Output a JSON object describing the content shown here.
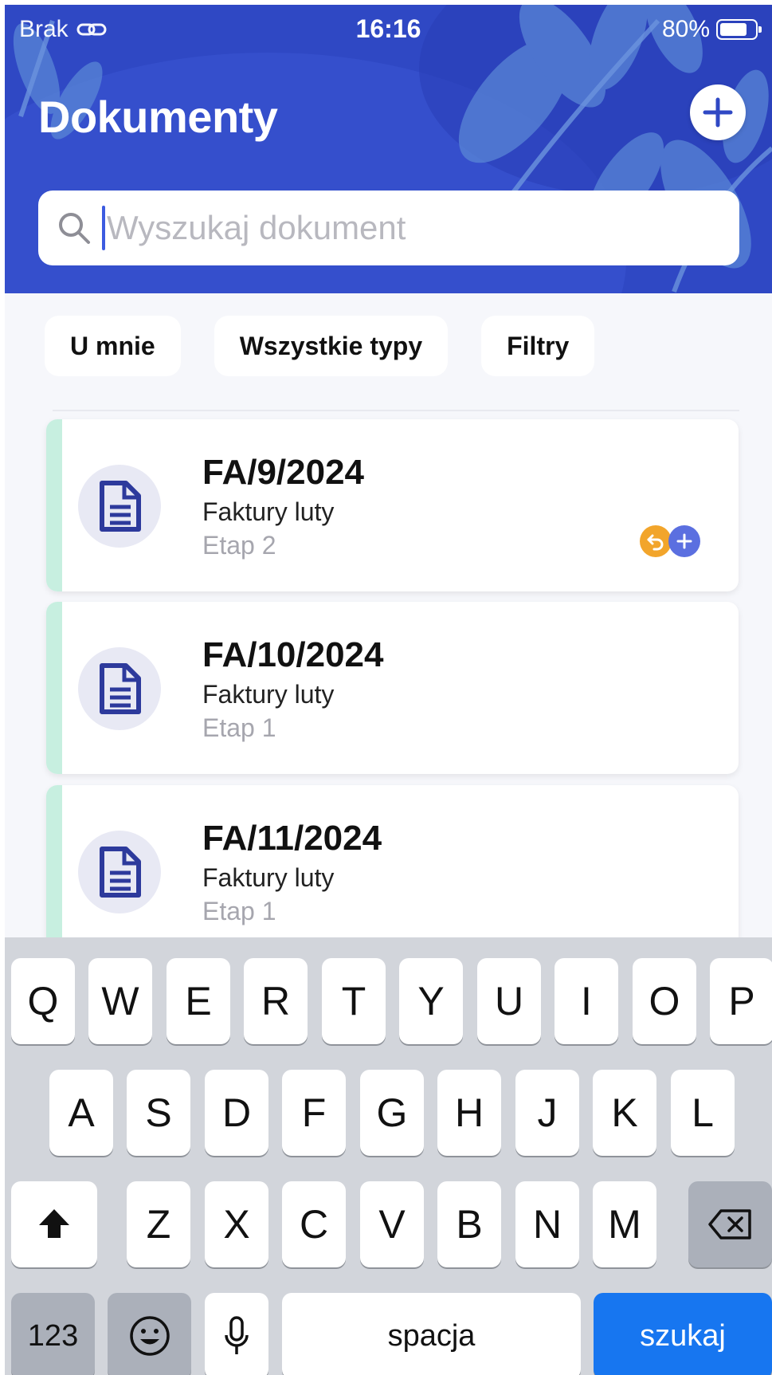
{
  "status_bar": {
    "carrier": "Brak",
    "time": "16:16",
    "battery": "80%",
    "battery_level": 0.8
  },
  "header": {
    "title": "Dokumenty"
  },
  "search": {
    "placeholder": "Wyszukaj dokument",
    "value": ""
  },
  "filters": {
    "chips": [
      "U mnie",
      "Wszystkie typy",
      "Filtry"
    ]
  },
  "documents": [
    {
      "number": "FA/9/2024",
      "type": "Faktury luty",
      "stage": "Etap 2",
      "badges": [
        "reply-icon",
        "plus-icon"
      ]
    },
    {
      "number": "FA/10/2024",
      "type": "Faktury luty",
      "stage": "Etap 1",
      "badges": []
    },
    {
      "number": "FA/11/2024",
      "type": "Faktury luty",
      "stage": "Etap 1",
      "badges": []
    }
  ],
  "keyboard": {
    "row1": [
      "Q",
      "W",
      "E",
      "R",
      "T",
      "Y",
      "U",
      "I",
      "O",
      "P"
    ],
    "row2": [
      "A",
      "S",
      "D",
      "F",
      "G",
      "H",
      "J",
      "K",
      "L"
    ],
    "row3": [
      "Z",
      "X",
      "C",
      "V",
      "B",
      "N",
      "M"
    ],
    "numbers_key": "123",
    "space_key": "spacja",
    "search_key": "szukaj"
  },
  "colors": {
    "header_bg": "#2f48c4",
    "accent": "#3c5be0",
    "card_stripe": "#c7efe0",
    "doc_icon": "#2d3a9c",
    "badge_orange": "#f2a52b",
    "badge_blue": "#5b6fe0",
    "keyboard_action": "#1776f0"
  }
}
